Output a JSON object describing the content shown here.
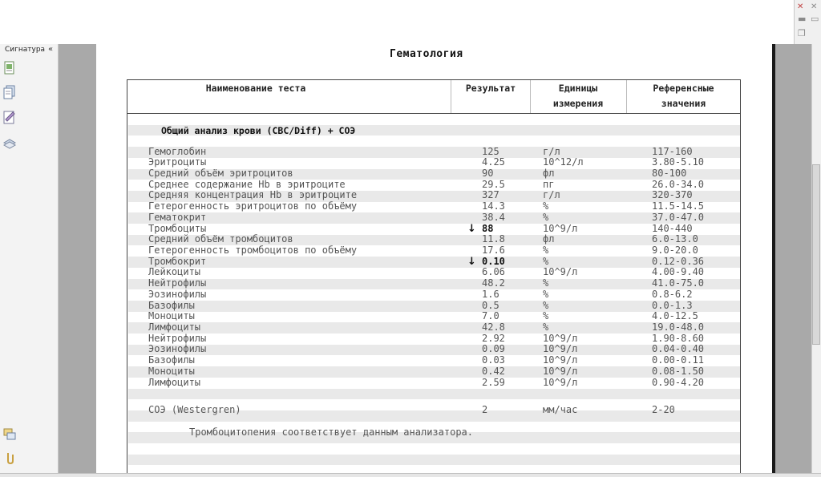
{
  "sidebar": {
    "signature_tab": "Сигнатура",
    "collapse_glyph": "«"
  },
  "icons": [
    "page-thumbnails-icon",
    "pages-icon",
    "signature-icon",
    "layers-icon",
    "attachments-icon",
    "paperclip-icon"
  ],
  "document": {
    "title": "Гематология",
    "headers": {
      "name": "Наименование теста",
      "result": "Результат",
      "units_1": "Единицы",
      "units_2": "измерения",
      "ref_1": "Референсные",
      "ref_2": "значения"
    },
    "section": "Общий анализ крови (CBC/Diff) + СОЭ",
    "rows": [
      {
        "name": "Гемоглобин",
        "result": "125",
        "unit": "г/л",
        "ref": "117-160",
        "flag": ""
      },
      {
        "name": "Эритроциты",
        "result": "4.25",
        "unit": "10^12/л",
        "ref": "3.80-5.10",
        "flag": ""
      },
      {
        "name": "Средний объём эритроцитов",
        "result": "90",
        "unit": "фл",
        "ref": "80-100",
        "flag": ""
      },
      {
        "name": "Среднее содержание Hb в эритроците",
        "result": "29.5",
        "unit": "пг",
        "ref": "26.0-34.0",
        "flag": ""
      },
      {
        "name": "Средняя концентрация Hb в эритроците",
        "result": "327",
        "unit": "г/л",
        "ref": "320-370",
        "flag": ""
      },
      {
        "name": "Гетерогенность эритроцитов по объёму",
        "result": "14.3",
        "unit": "%",
        "ref": "11.5-14.5",
        "flag": ""
      },
      {
        "name": "Гематокрит",
        "result": "38.4",
        "unit": "%",
        "ref": "37.0-47.0",
        "flag": ""
      },
      {
        "name": "Тромбоциты",
        "result": "88",
        "unit": "10^9/л",
        "ref": "140-440",
        "flag": "↓"
      },
      {
        "name": "Средний объём тромбоцитов",
        "result": "11.8",
        "unit": "фл",
        "ref": "6.0-13.0",
        "flag": ""
      },
      {
        "name": "Гетерогенность тромбоцитов по объёму",
        "result": "17.6",
        "unit": "%",
        "ref": "9.0-20.0",
        "flag": ""
      },
      {
        "name": "Тромбокрит",
        "result": "0.10",
        "unit": "%",
        "ref": "0.12-0.36",
        "flag": "↓"
      },
      {
        "name": "Лейкоциты",
        "result": "6.06",
        "unit": "10^9/л",
        "ref": "4.00-9.40",
        "flag": ""
      },
      {
        "name": "Нейтрофилы",
        "result": "48.2",
        "unit": "%",
        "ref": "41.0-75.0",
        "flag": ""
      },
      {
        "name": "Эозинофилы",
        "result": "1.6",
        "unit": "%",
        "ref": "0.8-6.2",
        "flag": ""
      },
      {
        "name": "Базофилы",
        "result": "0.5",
        "unit": "%",
        "ref": "0.0-1.3",
        "flag": ""
      },
      {
        "name": "Моноциты",
        "result": "7.0",
        "unit": "%",
        "ref": "4.0-12.5",
        "flag": ""
      },
      {
        "name": "Лимфоциты",
        "result": "42.8",
        "unit": "%",
        "ref": "19.0-48.0",
        "flag": ""
      },
      {
        "name": "Нейтрофилы",
        "result": "2.92",
        "unit": "10^9/л",
        "ref": "1.90-8.60",
        "flag": ""
      },
      {
        "name": "Эозинофилы",
        "result": "0.09",
        "unit": "10^9/л",
        "ref": "0.04-0.40",
        "flag": ""
      },
      {
        "name": "Базофилы",
        "result": "0.03",
        "unit": "10^9/л",
        "ref": "0.00-0.11",
        "flag": ""
      },
      {
        "name": "Моноциты",
        "result": "0.42",
        "unit": "10^9/л",
        "ref": "0.08-1.50",
        "flag": ""
      },
      {
        "name": "Лимфоциты",
        "result": "2.59",
        "unit": "10^9/л",
        "ref": "0.90-4.20",
        "flag": ""
      }
    ],
    "esr": {
      "name": "СОЭ (Westergren)",
      "result": "2",
      "unit": "мм/час",
      "ref": "2-20"
    },
    "comment": "Тромбоцитопения соответствует данным анализатора."
  }
}
